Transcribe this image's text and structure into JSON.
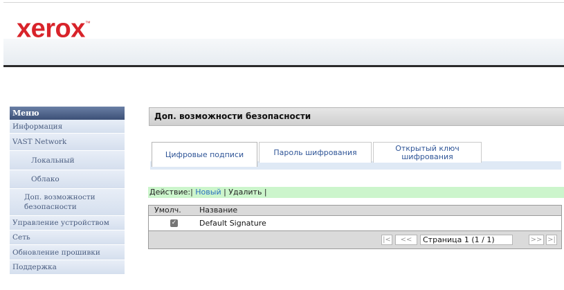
{
  "header": {
    "logo": "xerox",
    "logo_mark": "™"
  },
  "sidebar": {
    "title": "Меню",
    "items": [
      {
        "label": "Информация"
      },
      {
        "label": "VAST Network"
      },
      {
        "label": "Локальный"
      },
      {
        "label": "Облако"
      },
      {
        "label": "Доп. возможности безопасности"
      },
      {
        "label": "Управление устройством"
      },
      {
        "label": "Сеть"
      },
      {
        "label": "Обновление прошивки"
      },
      {
        "label": "Поддержка"
      }
    ]
  },
  "main": {
    "title": "Доп. возможности безопасности",
    "tabs": [
      {
        "label": "Цифровые подписи",
        "active": true
      },
      {
        "label": "Пароль шифрования",
        "active": false
      },
      {
        "label": "Открытый ключ шифрования",
        "active": false
      }
    ],
    "action_bar": {
      "prefix": "Действие:|",
      "new_label": "Новый",
      "delete_label": "| Удалить |"
    },
    "table": {
      "headers": [
        "Умолч.",
        "Название"
      ],
      "rows": [
        {
          "default": true,
          "name": "Default Signature"
        }
      ]
    },
    "pager": {
      "first_label": "|<",
      "prev_label": "<<",
      "page_text": "Страница 1 (1 / 1)",
      "next_label": ">>",
      "last_label": ">|"
    }
  },
  "colors": {
    "brand": "#d8232a",
    "menu_header": "#3c5077",
    "action_bar": "#ccf5cc",
    "link": "#2a6fbf"
  }
}
